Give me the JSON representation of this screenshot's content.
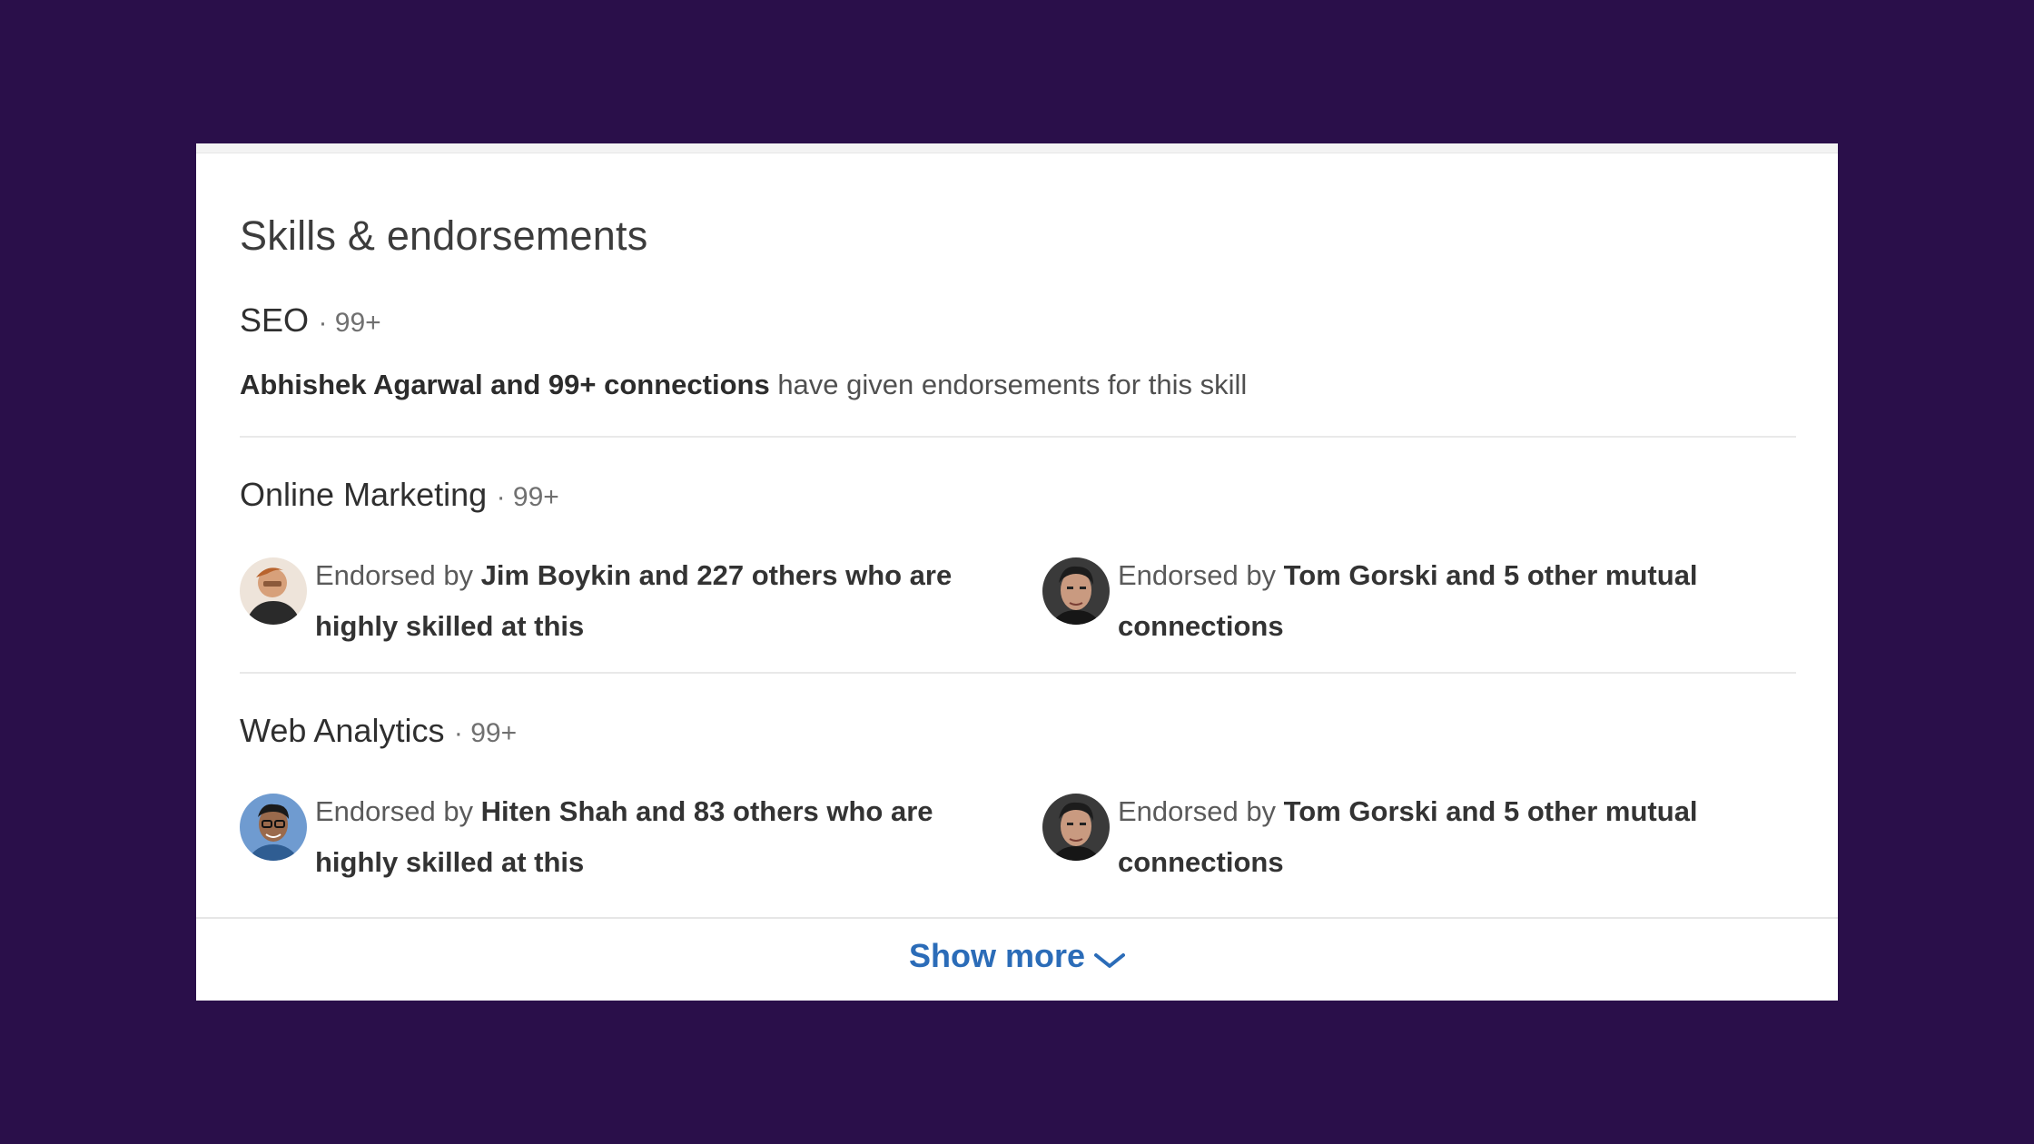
{
  "section": {
    "title": "Skills & endorsements"
  },
  "skills": [
    {
      "name": "SEO",
      "count": "· 99+",
      "summary": {
        "bold": "Abhishek Agarwal and 99+ connections",
        "rest": " have given endorsements for this skill"
      }
    },
    {
      "name": "Online Marketing",
      "count": "· 99+",
      "endorsements": [
        {
          "lead": "Endorsed by ",
          "bold": "Jim Boykin and 227 others who are highly skilled at this",
          "avatar": "person-photo-jim-boykin"
        },
        {
          "lead": "Endorsed by ",
          "bold": "Tom Gorski and 5 other mutual connections",
          "avatar": "person-photo-tom-gorski"
        }
      ]
    },
    {
      "name": "Web Analytics",
      "count": "· 99+",
      "endorsements": [
        {
          "lead": "Endorsed by ",
          "bold": "Hiten Shah and 83 others who are highly skilled at this",
          "avatar": "person-photo-hiten-shah"
        },
        {
          "lead": "Endorsed by ",
          "bold": "Tom Gorski and 5 other mutual connections",
          "avatar": "person-photo-tom-gorski"
        }
      ]
    }
  ],
  "footer": {
    "show_more": "Show more",
    "icon": "chevron-down-icon"
  },
  "colors": {
    "background": "#2a0f4a",
    "card": "#ffffff",
    "link": "#2b6cb8"
  }
}
